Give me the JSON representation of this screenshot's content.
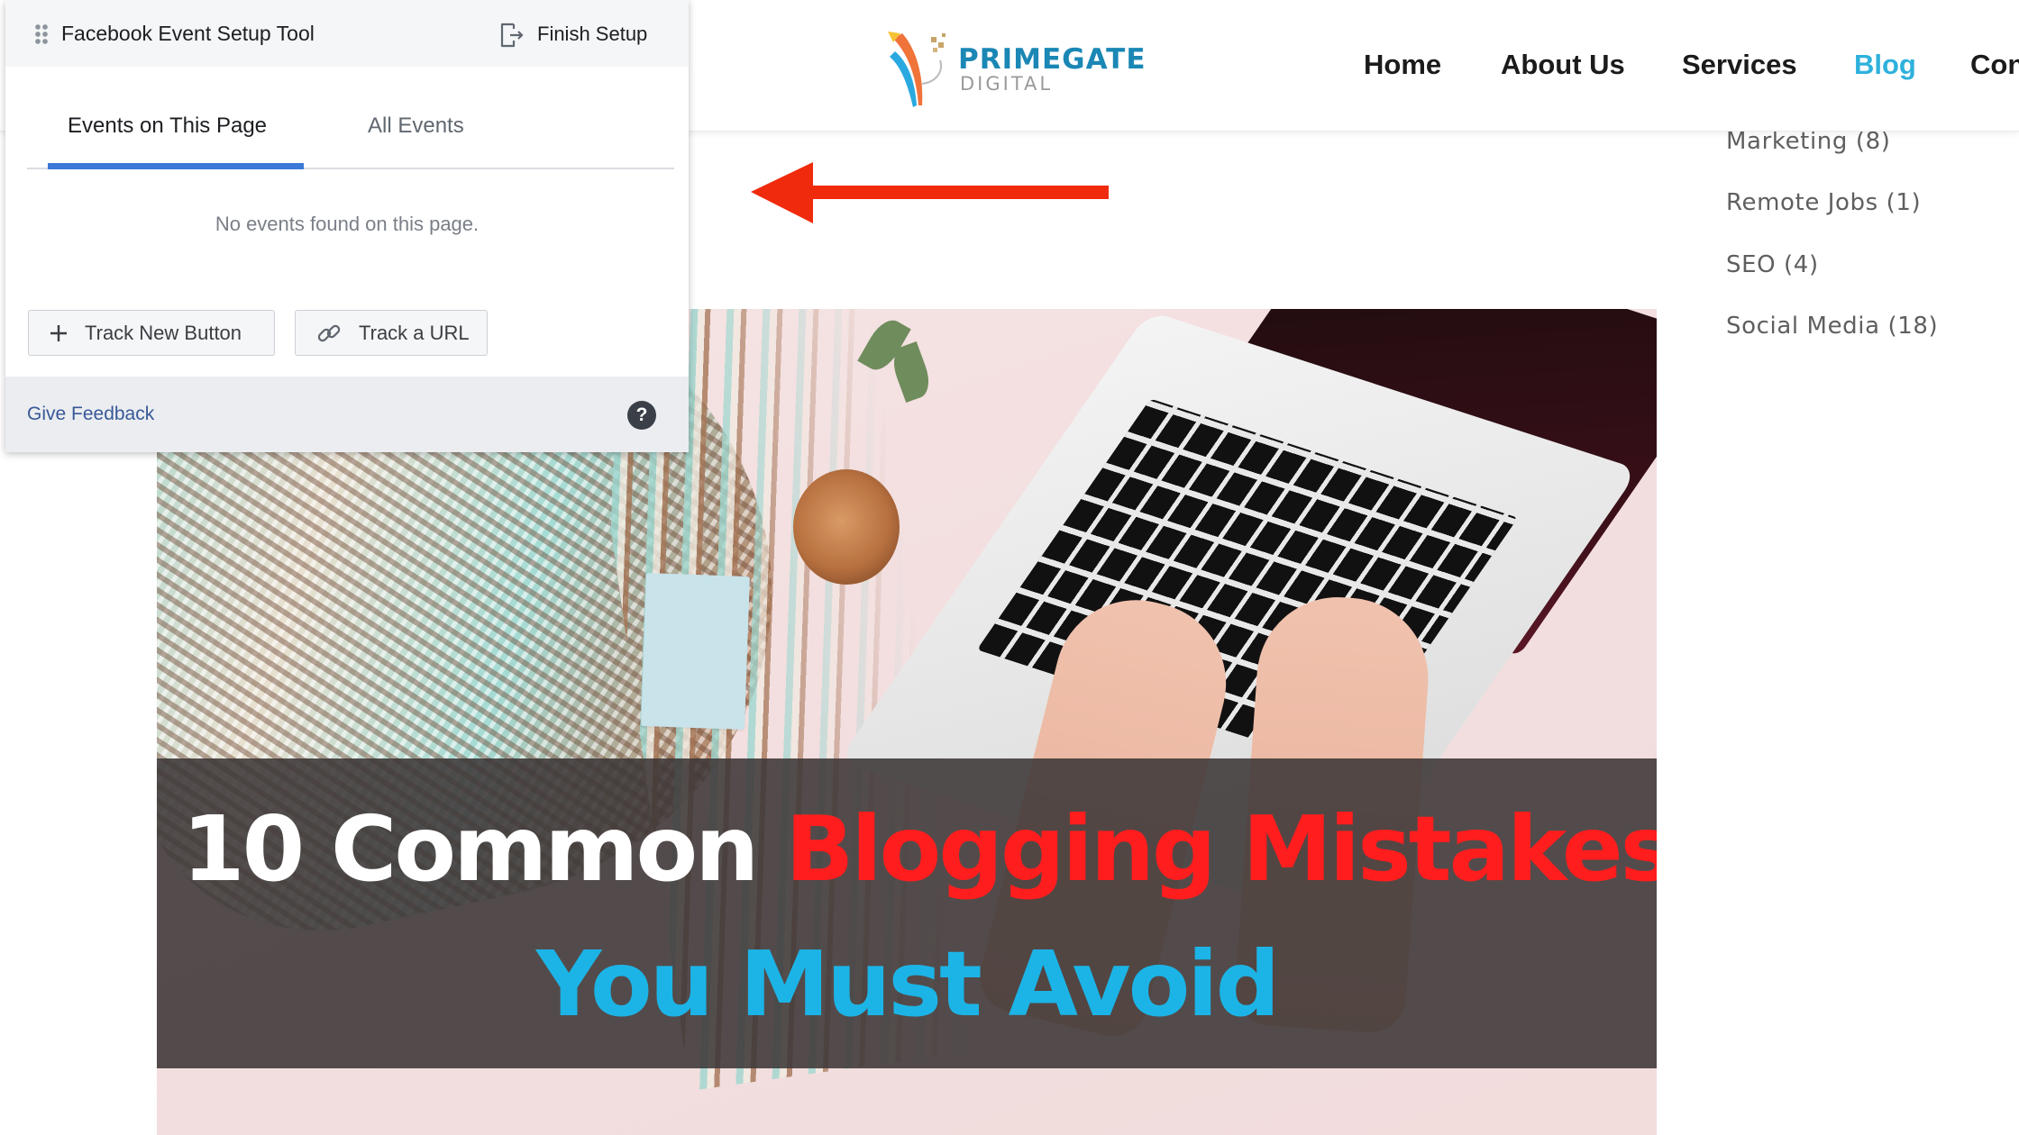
{
  "site": {
    "logo": {
      "name": "PRIMEGATE",
      "sub": "DIGITAL"
    },
    "nav": [
      {
        "label": "Home",
        "active": false
      },
      {
        "label": "About Us",
        "active": false
      },
      {
        "label": "Services",
        "active": false
      },
      {
        "label": "Blog",
        "active": true
      },
      {
        "label": "Con",
        "active": false
      }
    ],
    "categories": [
      {
        "label": "Marketing (8)"
      },
      {
        "label": "Remote Jobs (1)"
      },
      {
        "label": "SEO (4)"
      },
      {
        "label": "Social Media (18)"
      }
    ],
    "hero": {
      "line1_white": "10 Common",
      "line1_red": "Blogging Mistakes",
      "line2_cyan": "You Must Avoid"
    }
  },
  "fb_tool": {
    "title": "Facebook Event Setup Tool",
    "finish_label": "Finish Setup",
    "tabs": [
      {
        "label": "Events on This Page",
        "active": true
      },
      {
        "label": "All Events",
        "active": false
      }
    ],
    "empty_message": "No events found on this page.",
    "buttons": {
      "track_new": "Track New Button",
      "track_url": "Track a URL"
    },
    "footer": {
      "feedback_label": "Give Feedback",
      "help_glyph": "?"
    }
  },
  "annotation": {
    "type": "arrow",
    "direction": "left",
    "color": "#f02a0c"
  },
  "colors": {
    "accent_tab": "#3b78d8",
    "nav_active": "#2eb1dc",
    "link": "#385898",
    "headline_red": "#ff1d1d",
    "headline_cyan": "#1cb4e6"
  }
}
